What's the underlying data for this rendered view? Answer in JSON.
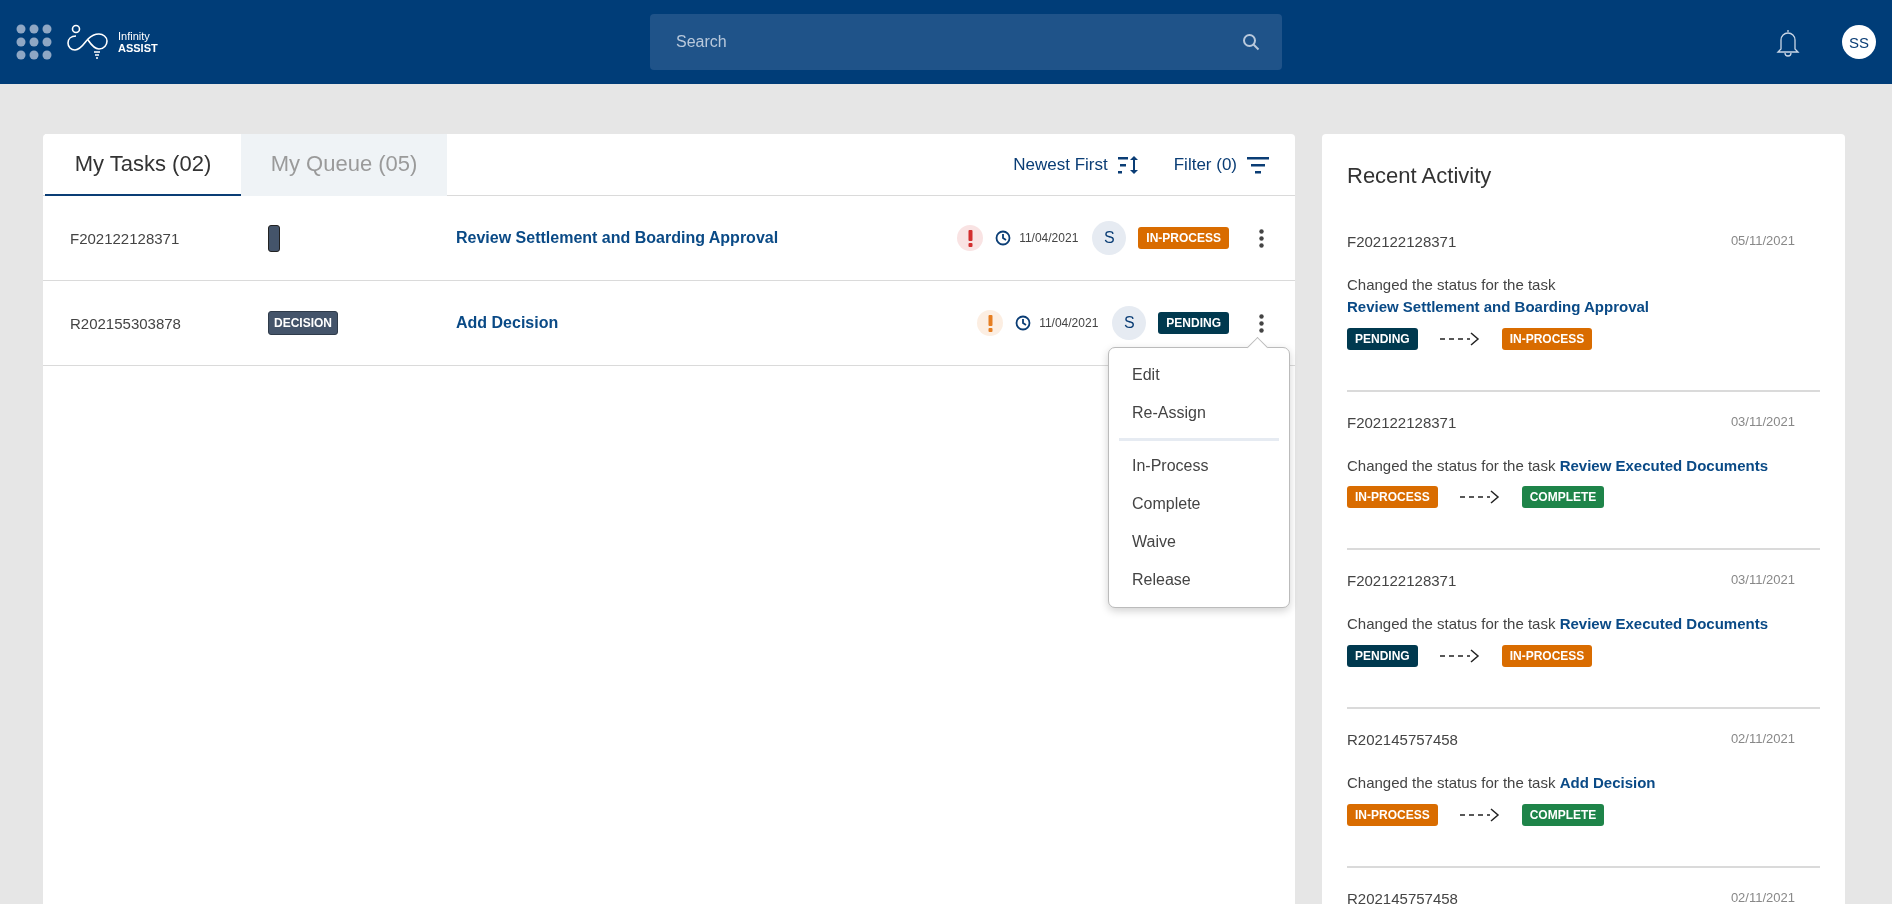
{
  "header": {
    "brand": {
      "name": "Infinity",
      "product": "ASSIST"
    },
    "search": {
      "placeholder": "Search"
    },
    "avatar": "SS"
  },
  "tasks": {
    "tabs": [
      {
        "label": "My Tasks (02)",
        "selected": true
      },
      {
        "label": "My Queue (05)",
        "selected": false
      }
    ],
    "sort": "Newest First",
    "filter": "Filter (0)",
    "rows": [
      {
        "id": "F202122128371",
        "tag": {
          "kind": "blank"
        },
        "title": "Review Settlement and Boarding Approval",
        "color": "#d32f2f",
        "date": "11/04/2021",
        "assignee": "S",
        "status": {
          "kind": "in-process",
          "label": "IN-PROCESS"
        },
        "menu_open": false
      },
      {
        "id": "R202155303878",
        "tag": {
          "kind": "label",
          "text": "DECISION"
        },
        "title": "Add Decision",
        "color": "#e67e22",
        "date": "11/04/2021",
        "assignee": "S",
        "status": {
          "kind": "pending",
          "label": "PENDING"
        },
        "menu_open": true
      }
    ],
    "menu": {
      "groups": [
        [
          "Edit",
          "Re-Assign"
        ],
        [
          "In-Process",
          "Complete",
          "Waive",
          "Release"
        ]
      ]
    }
  },
  "activity": {
    "title": "Recent Activity",
    "items": [
      {
        "id": "F202122128371",
        "date": "05/11/2021",
        "text": "Changed the status for the task",
        "task": "Review Settlement and Boarding Approval",
        "from": {
          "kind": "pending",
          "label": "PENDING"
        },
        "to": {
          "kind": "in-process",
          "label": "IN-PROCESS"
        }
      },
      {
        "id": "F202122128371",
        "date": "03/11/2021",
        "text": "Changed the status for the task",
        "task": "Review Executed Documents",
        "from": {
          "kind": "in-process",
          "label": "IN-PROCESS"
        },
        "to": {
          "kind": "complete",
          "label": "COMPLETE"
        }
      },
      {
        "id": "F202122128371",
        "date": "03/11/2021",
        "text": "Changed the status for the task",
        "task": "Review Executed Documents",
        "from": {
          "kind": "pending",
          "label": "PENDING"
        },
        "to": {
          "kind": "in-process",
          "label": "IN-PROCESS"
        }
      },
      {
        "id": "R202145757458",
        "date": "02/11/2021",
        "text": "Changed the status for the task",
        "task": "Add Decision",
        "from": {
          "kind": "in-process",
          "label": "IN-PROCESS"
        },
        "to": {
          "kind": "complete",
          "label": "COMPLETE"
        }
      },
      {
        "id": "R202145757458",
        "date": "02/11/2021"
      }
    ]
  }
}
